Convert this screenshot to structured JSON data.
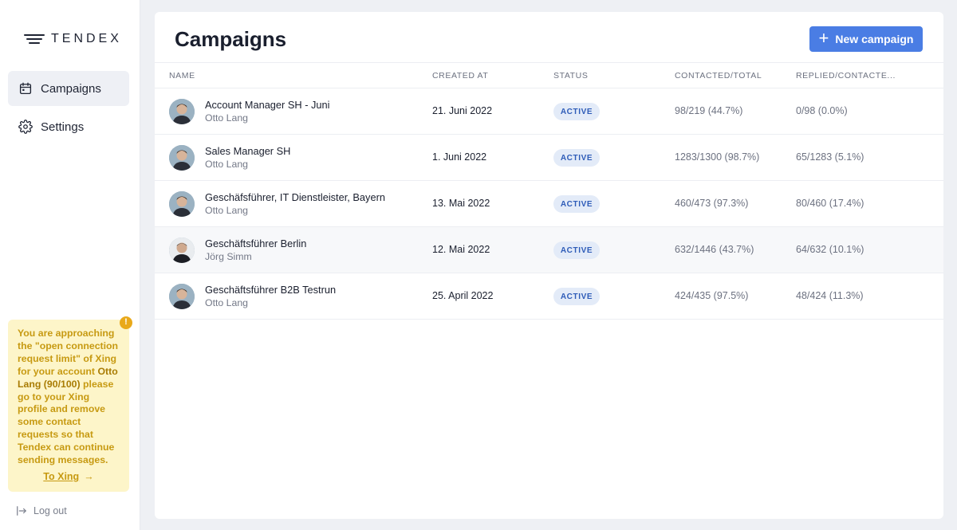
{
  "brand": {
    "name": "TENDEX"
  },
  "nav": [
    {
      "label": "Campaigns",
      "icon": "calendar-icon",
      "active": true
    },
    {
      "label": "Settings",
      "icon": "gear-icon",
      "active": false
    }
  ],
  "warning": {
    "text_before": "You are approaching the \"open connection request limit\" of Xing for your account ",
    "account": "Otto Lang (90/100)",
    "text_after": " please go to your Xing profile and remove some contact requests so that Tendex can continue sending messages.",
    "link_label": "To Xing",
    "badge": "!"
  },
  "logout_label": "Log out",
  "page": {
    "title": "Campaigns",
    "new_button": "New campaign"
  },
  "table": {
    "headers": {
      "name": "NAME",
      "created": "CREATED AT",
      "status": "STATUS",
      "contacted": "CONTACTED/TOTAL",
      "replied": "REPLIED/CONTACTE..."
    },
    "rows": [
      {
        "title": "Account Manager SH - Juni",
        "owner": "Otto Lang",
        "created": "21. Juni 2022",
        "status": "ACTIVE",
        "contacted": "98/219 (44.7%)",
        "replied": "0/98 (0.0%)"
      },
      {
        "title": "Sales Manager SH",
        "owner": "Otto Lang",
        "created": "1. Juni 2022",
        "status": "ACTIVE",
        "contacted": "1283/1300 (98.7%)",
        "replied": "65/1283 (5.1%)"
      },
      {
        "title": "Geschäfsführer, IT Dienstleister, Bayern",
        "owner": "Otto Lang",
        "created": "13. Mai 2022",
        "status": "ACTIVE",
        "contacted": "460/473 (97.3%)",
        "replied": "80/460 (17.4%)"
      },
      {
        "title": "Geschäftsführer Berlin",
        "owner": "Jörg Simm",
        "created": "12. Mai 2022",
        "status": "ACTIVE",
        "contacted": "632/1446 (43.7%)",
        "replied": "64/632 (10.1%)"
      },
      {
        "title": "Geschäftsführer B2B Testrun",
        "owner": "Otto Lang",
        "created": "25. April 2022",
        "status": "ACTIVE",
        "contacted": "424/435 (97.5%)",
        "replied": "48/424 (11.3%)"
      }
    ]
  },
  "colors": {
    "accent": "#4a7de4",
    "warning_bg": "#fdf5c9",
    "warning_text": "#c79a12",
    "badge_bg": "#e3ebf8",
    "badge_text": "#2e5cb8"
  }
}
